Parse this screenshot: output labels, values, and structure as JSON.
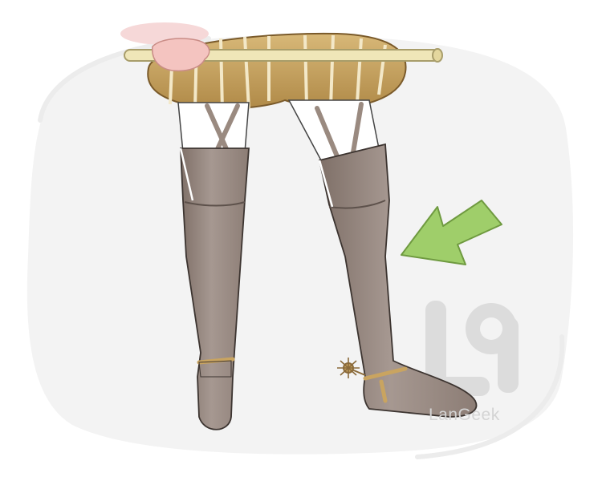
{
  "illustration": {
    "subject": "jackboots",
    "arrow_color": "#9fce6a",
    "boot_color": "#9a8a80",
    "breeches_color": "#c9a460",
    "stick_color": "#efe6b8"
  },
  "watermark": {
    "logo_icon": "langeek-logo-icon",
    "text": "LanGeek"
  }
}
